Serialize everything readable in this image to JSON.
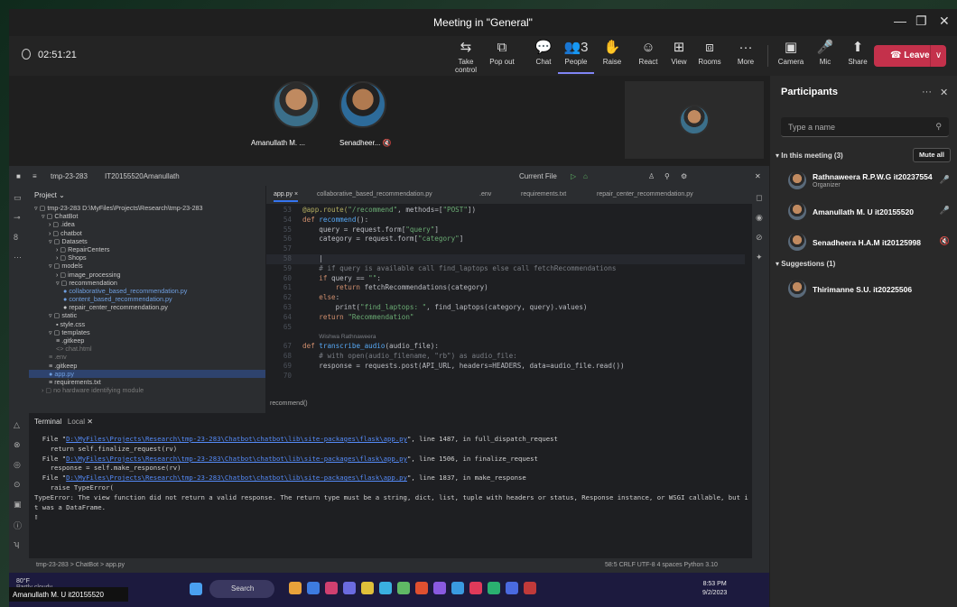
{
  "window": {
    "title": "Meeting in \"General\"",
    "minimize": "—",
    "maximize": "❐",
    "close": "✕"
  },
  "meeting": {
    "timer": "02:51:21",
    "toolbar": [
      {
        "label": "Take control",
        "icon": "⇆"
      },
      {
        "label": "Pop out",
        "icon": "⧉"
      },
      {
        "label": "Chat",
        "icon": "💬"
      },
      {
        "label": "People",
        "icon": "👥",
        "count": "3"
      },
      {
        "label": "Raise",
        "icon": "✋"
      },
      {
        "label": "React",
        "icon": "☺"
      },
      {
        "label": "View",
        "icon": "⊞"
      },
      {
        "label": "Rooms",
        "icon": "⧈"
      },
      {
        "label": "More",
        "icon": "···"
      },
      {
        "label": "Camera",
        "icon": "▣"
      },
      {
        "label": "Mic",
        "icon": "🎤"
      },
      {
        "label": "Share",
        "icon": "⬆"
      }
    ],
    "leave_label": "Leave",
    "leave_dropdown": "∨",
    "tiles": [
      {
        "name": "Amanullath M. ..."
      },
      {
        "name": "Senadheer..."
      }
    ],
    "name_overlay": "Amanullath M. U it20155520"
  },
  "participants": {
    "title": "Participants",
    "more": "···",
    "close": "✕",
    "search_placeholder": "Type a name",
    "in_meeting_label": "In this meeting (3)",
    "mute_all": "Mute all",
    "members": [
      {
        "name": "Rathnaweera R.P.W.G it20237554",
        "role": "Organizer",
        "mic": "🎤"
      },
      {
        "name": "Amanullath M. U it20155520",
        "role": "",
        "mic": "🎤"
      },
      {
        "name": "Senadheera H.A.M it20125998",
        "role": "",
        "mic": "🔇"
      }
    ],
    "suggestions_label": "Suggestions (1)",
    "suggestions": [
      {
        "name": "Thirimanne S.U. it20225506"
      }
    ]
  },
  "ide": {
    "project_name": "tmp-23-283",
    "branch": "IT20155520Amanullath",
    "run_config": "Current File",
    "project_label": "Project",
    "tree": [
      {
        "indent": 0,
        "text": "▿ ▢ tmp-23-283  D:\\MyFiles\\Projects\\Research\\tmp-23-283",
        "cls": ""
      },
      {
        "indent": 1,
        "text": "▿ ▢ ChatBot",
        "cls": ""
      },
      {
        "indent": 2,
        "text": "› ▢ .idea",
        "cls": ""
      },
      {
        "indent": 2,
        "text": "› ▢ chatbot",
        "cls": ""
      },
      {
        "indent": 2,
        "text": "▿ ▢ Datasets",
        "cls": ""
      },
      {
        "indent": 3,
        "text": "› ▢ RepairCenters",
        "cls": ""
      },
      {
        "indent": 3,
        "text": "› ▢ Shops",
        "cls": ""
      },
      {
        "indent": 2,
        "text": "▿ ▢ models",
        "cls": ""
      },
      {
        "indent": 3,
        "text": "› ▢ image_processing",
        "cls": ""
      },
      {
        "indent": 3,
        "text": "▿ ▢ recommendation",
        "cls": ""
      },
      {
        "indent": 4,
        "text": "● collaborative_based_recommendation.py",
        "cls": "blue"
      },
      {
        "indent": 4,
        "text": "● content_based_recommendation.py",
        "cls": "blue"
      },
      {
        "indent": 4,
        "text": "● repair_center_recommendation.py",
        "cls": ""
      },
      {
        "indent": 2,
        "text": "▿ ▢ static",
        "cls": ""
      },
      {
        "indent": 3,
        "text": "▪ style.css",
        "cls": ""
      },
      {
        "indent": 2,
        "text": "▿ ▢ templates",
        "cls": ""
      },
      {
        "indent": 3,
        "text": "≡ .gitkeep",
        "cls": ""
      },
      {
        "indent": 3,
        "text": "<> chat.html",
        "cls": "dim"
      },
      {
        "indent": 2,
        "text": "≡ .env",
        "cls": "dim"
      },
      {
        "indent": 2,
        "text": "≡ .gitkeep",
        "cls": ""
      },
      {
        "indent": 2,
        "text": "● app.py",
        "cls": "blue sel"
      },
      {
        "indent": 2,
        "text": "≡ requirements.txt",
        "cls": ""
      },
      {
        "indent": 1,
        "text": "› ▢ no hardware identifying module",
        "cls": "dim"
      }
    ],
    "tabs": [
      {
        "label": "app.py",
        "active": true
      },
      {
        "label": "collaborative_based_recommendation.py",
        "active": false
      },
      {
        "label": ".env",
        "active": false
      },
      {
        "label": "requirements.txt",
        "active": false
      },
      {
        "label": "repair_center_recommendation.py",
        "active": false
      }
    ],
    "breadcrumb_fn": "recommend()",
    "code": [
      {
        "n": "53",
        "html": "<span class=\"dec\">@app.route(</span><span class=\"str\">\"/recommend\"</span>, methods=[<span class=\"str\">\"POST\"</span>])"
      },
      {
        "n": "54",
        "html": "<span class=\"kw\">def </span><span class=\"fn\">recommend</span>():"
      },
      {
        "n": "55",
        "html": "    query = request.form[<span class=\"str\">\"query\"</span>]"
      },
      {
        "n": "56",
        "html": "    category = request.form[<span class=\"str\">\"category\"</span>]"
      },
      {
        "n": "57",
        "html": ""
      },
      {
        "n": "58",
        "html": "    |",
        "cur": true
      },
      {
        "n": "59",
        "html": "    <span class=\"cm\"># if query is available call find_laptops else call fetchRecommendations</span>"
      },
      {
        "n": "60",
        "html": "    <span class=\"kw\">if </span>query == <span class=\"str\">\"\"</span>:"
      },
      {
        "n": "61",
        "html": "        <span class=\"kw\">return </span>fetchRecommendations(category)"
      },
      {
        "n": "62",
        "html": "    <span class=\"kw\">else</span>:"
      },
      {
        "n": "63",
        "html": "        print(<span class=\"str\">\"find_laptops: \"</span>, find_laptops(category, query).values)"
      },
      {
        "n": "64",
        "html": "    <span class=\"kw\">return </span><span class=\"str\">\"Recommendation\"</span>"
      },
      {
        "n": "65",
        "html": ""
      },
      {
        "n": "",
        "html": "    <span class=\"hint\">Wishwa Rathnaweera</span>"
      },
      {
        "n": "67",
        "html": "<span class=\"kw\">def </span><span class=\"fn\">transcribe_audio</span>(audio_file):"
      },
      {
        "n": "68",
        "html": "    <span class=\"cm\"># with open(audio_filename, \"rb\") as audio_file:</span>"
      },
      {
        "n": "69",
        "html": "    response = requests.post(API_URL, headers=HEADERS, data=audio_file.read())"
      },
      {
        "n": "70",
        "html": ""
      }
    ],
    "terminal_label": "Terminal",
    "terminal_tab": "Local",
    "terminal": [
      {
        "pre": "  File \"",
        "link": "D:\\MyFiles\\Projects\\Research\\tmp-23-283\\Chatbot\\chatbot\\lib\\site-packages\\flask\\app.py",
        "post": "\", line 1487, in full_dispatch_request"
      },
      {
        "pre": "    return self.finalize_request(rv)",
        "link": "",
        "post": ""
      },
      {
        "pre": "  File \"",
        "link": "D:\\MyFiles\\Projects\\Research\\tmp-23-283\\Chatbot\\chatbot\\lib\\site-packages\\flask\\app.py",
        "post": "\", line 1506, in finalize_request"
      },
      {
        "pre": "    response = self.make_response(rv)",
        "link": "",
        "post": ""
      },
      {
        "pre": "  File \"",
        "link": "D:\\MyFiles\\Projects\\Research\\tmp-23-283\\Chatbot\\chatbot\\lib\\site-packages\\flask\\app.py",
        "post": "\", line 1837, in make_response"
      },
      {
        "pre": "    raise TypeError(",
        "link": "",
        "post": ""
      },
      {
        "pre": "TypeError: The view function did not return a valid response. The return type must be a string, dict, list, tuple with headers or status, Response instance, or WSGI callable, but i",
        "link": "",
        "post": ""
      },
      {
        "pre": "t was a DataFrame.",
        "link": "",
        "post": ""
      },
      {
        "pre": "▯",
        "link": "",
        "post": ""
      }
    ],
    "status_path": "tmp-23-283  >  ChatBot  >  app.py",
    "status_right": "58:5   CRLF   UTF-8   4 spaces   Python 3.10"
  },
  "taskbar": {
    "temp": "80°F",
    "weather": "Partly cloudy",
    "search": "Search",
    "time": "8:53 PM",
    "date": "9/2/2023"
  }
}
